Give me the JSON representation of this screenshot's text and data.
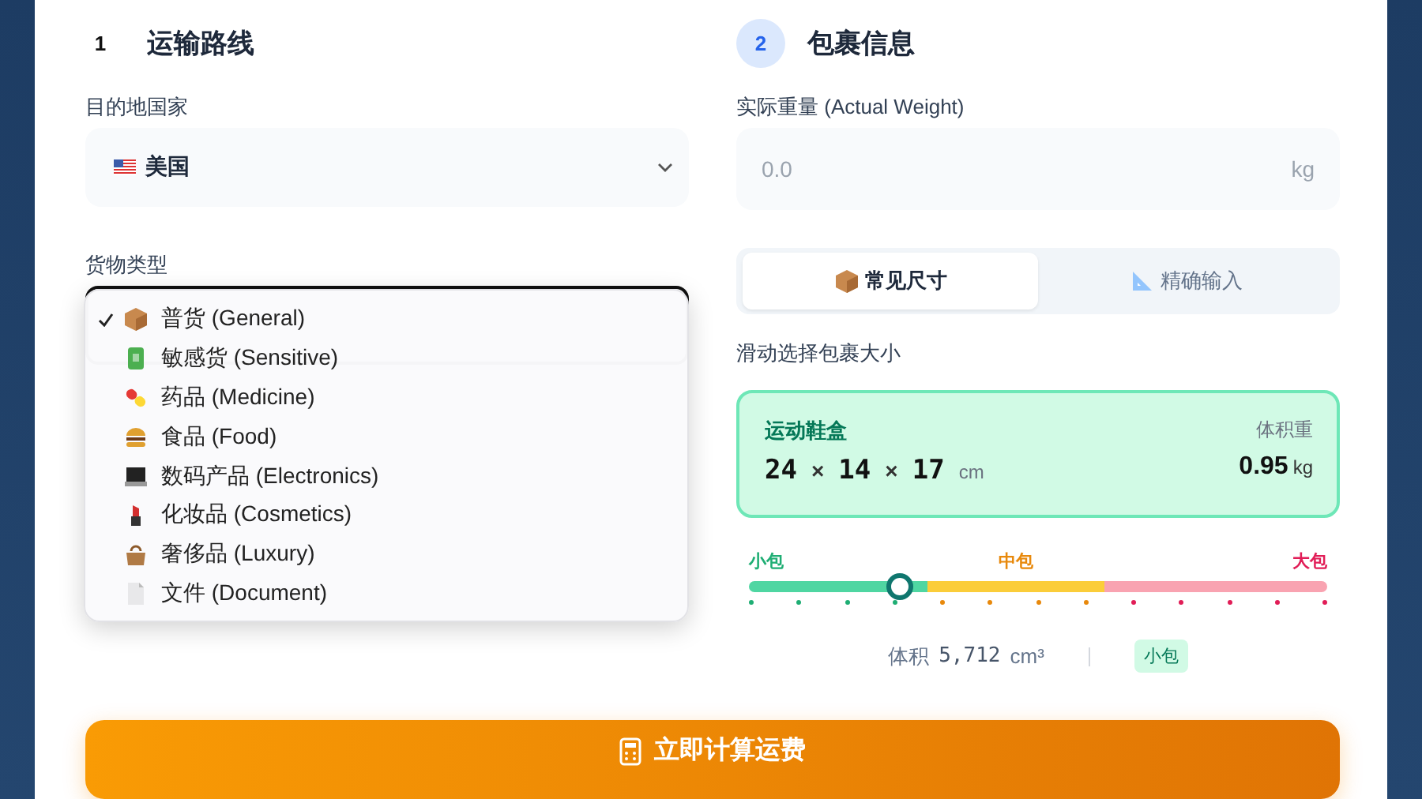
{
  "route": {
    "step": "1",
    "step_active": false,
    "title": "运输路线",
    "country_label": "目的地国家",
    "country": {
      "value": "美国"
    },
    "cargo_label": "货物类型",
    "cargo_options": [
      {
        "kind": "box",
        "label": "普货 (General)",
        "selected": true
      },
      {
        "kind": "bottle",
        "label": "敏感货 (Sensitive)",
        "selected": false
      },
      {
        "kind": "pill",
        "label": "药品 (Medicine)",
        "selected": false
      },
      {
        "kind": "burger",
        "label": "食品 (Food)",
        "selected": false
      },
      {
        "kind": "laptop",
        "label": "数码产品 (Electronics)",
        "selected": false
      },
      {
        "kind": "lipstick",
        "label": "化妆品 (Cosmetics)",
        "selected": false
      },
      {
        "kind": "handbag",
        "label": "奢侈品 (Luxury)",
        "selected": false
      },
      {
        "kind": "document",
        "label": "文件 (Document)",
        "selected": false
      }
    ]
  },
  "parcel": {
    "step": "2",
    "step_active": true,
    "title": "包裹信息",
    "weight_label": "实际重量 (Actual Weight)",
    "weight_placeholder": "0.0",
    "weight_unit": "kg",
    "tabs": [
      {
        "kind": "box",
        "label": "常见尺寸",
        "selected": true
      },
      {
        "kind": "ruler",
        "label": "精确输入",
        "selected": false
      }
    ],
    "slider_label": "滑动选择包裹大小",
    "preset": {
      "name": "运动鞋盒",
      "dims": [
        "24",
        "14",
        "17"
      ],
      "separators": [
        "×",
        "×"
      ],
      "dim_unit": "cm",
      "vol_weight_label": "体积重",
      "vol_weight": "0.95",
      "vol_weight_unit": "kg"
    },
    "segments": [
      {
        "label": "小包",
        "color": "#1fae74"
      },
      {
        "label": "中包",
        "color": "#e8890c"
      },
      {
        "label": "大包",
        "color": "#e11d57"
      }
    ],
    "slider": {
      "level": 0.26
    },
    "volume_label": "体积",
    "volume_value": "5,712",
    "volume_unit": "cm³",
    "size_badge": "小包"
  },
  "calc_button": "立即计算运费"
}
